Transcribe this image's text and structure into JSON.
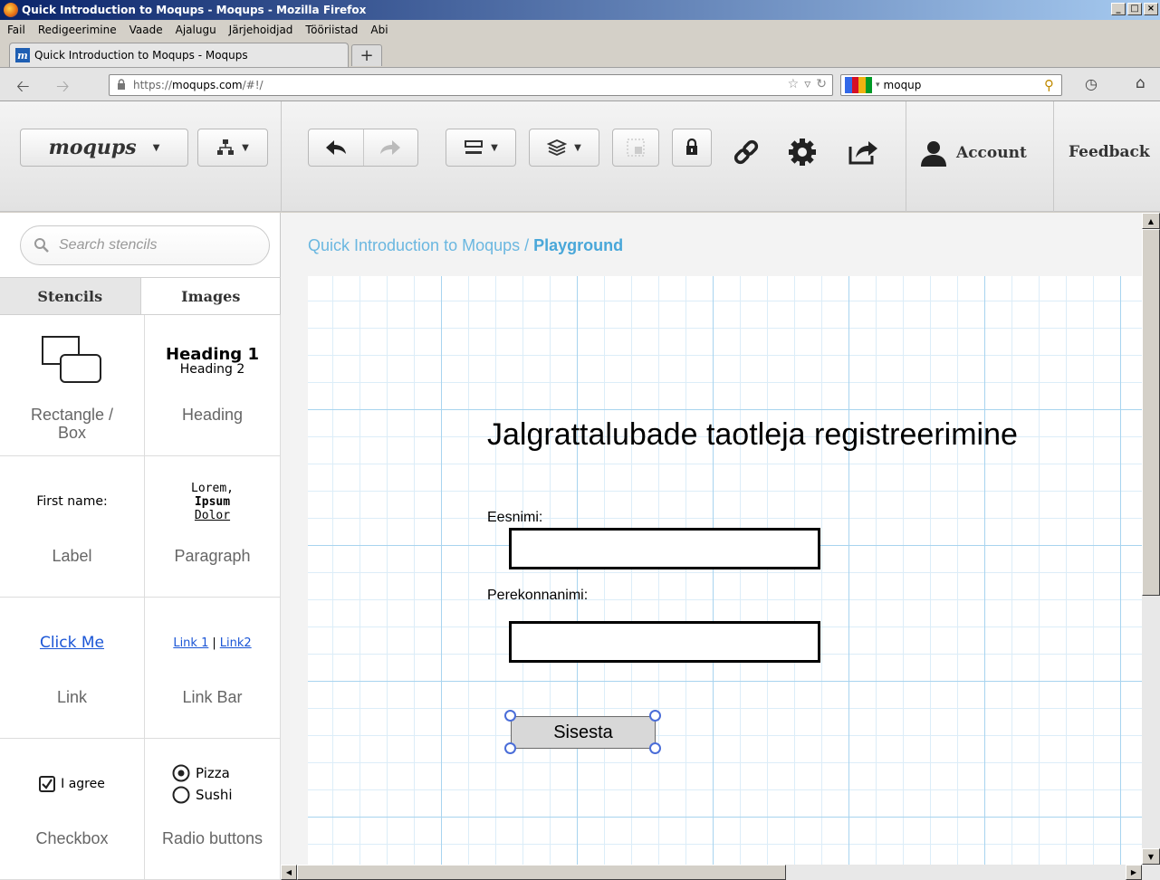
{
  "window": {
    "title": "Quick Introduction to Moqups - Moqups - Mozilla Firefox",
    "controls": [
      "_",
      "□",
      "×"
    ]
  },
  "menu": [
    "Fail",
    "Redigeerimine",
    "Vaade",
    "Ajalugu",
    "Järjehoidjad",
    "Tööriistad",
    "Abi"
  ],
  "tab": {
    "title": "Quick Introduction to Moqups - Moqups",
    "icon": "m-icon"
  },
  "address": {
    "scheme": "https://",
    "domain": "moqups.com",
    "path": "/#!/"
  },
  "search": {
    "value": "moqup",
    "engine": "google-icon"
  },
  "app": {
    "logo": "moqups",
    "account_label": "Account",
    "feedback_label": "Feedback"
  },
  "sidebar": {
    "search_placeholder": "Search stencils",
    "tabs": [
      "Stencils",
      "Images"
    ],
    "stencils": [
      {
        "caption": "Rectangle / Box"
      },
      {
        "caption": "Heading",
        "preview_h1": "Heading 1",
        "preview_h2": "Heading 2"
      },
      {
        "caption": "Label",
        "preview": "First name:"
      },
      {
        "caption": "Paragraph",
        "preview_lines": [
          "Lorem,",
          "Ipsum",
          "Dolor"
        ]
      },
      {
        "caption": "Link",
        "preview": "Click Me"
      },
      {
        "caption": "Link Bar",
        "preview_a": "Link 1",
        "preview_sep": "|",
        "preview_b": "Link2"
      },
      {
        "caption": "Checkbox",
        "preview": "I agree"
      },
      {
        "caption": "Radio buttons",
        "preview_a": "Pizza",
        "preview_b": "Sushi"
      }
    ]
  },
  "breadcrumb": {
    "project": "Quick Introduction to Moqups",
    "sep": " / ",
    "page": "Playground"
  },
  "mockup": {
    "heading": "Jalgrattalubade taotleja registreerimine",
    "first_name_label": "Eesnimi:",
    "last_name_label": "Perekonnanimi:",
    "submit_label": "Sisesta"
  },
  "colors": {
    "accent": "#49a7d9",
    "grid_major": "#a8d4ef",
    "grid_minor": "#dcedf8",
    "handle": "#4a6dd8"
  }
}
